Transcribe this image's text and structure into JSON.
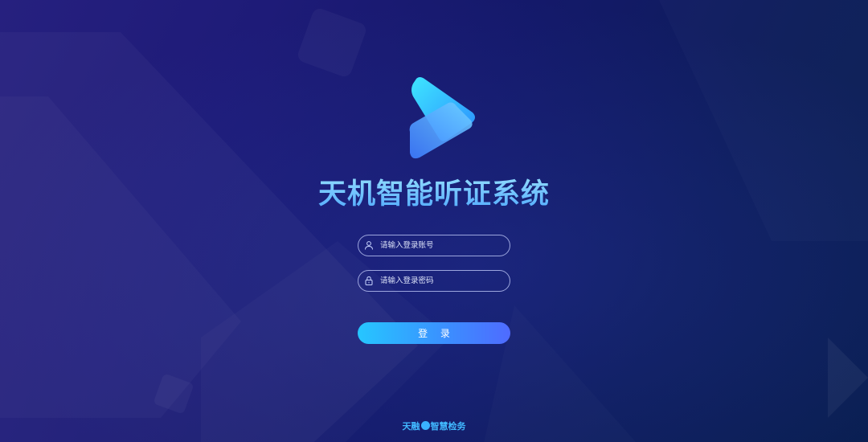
{
  "app": {
    "title": "天机智能听证系统"
  },
  "login_form": {
    "username": {
      "placeholder": "请输入登录账号",
      "value": "",
      "icon": "user-icon"
    },
    "password": {
      "placeholder": "请输入登录密码",
      "value": "",
      "icon": "lock-icon"
    },
    "submit_label": "登 录"
  },
  "footer": {
    "brand_prefix": "天融",
    "brand_suffix": "智慧检务",
    "logo_icon": "brand-mark-icon"
  },
  "colors": {
    "accent": "#3c8dff",
    "button_start": "#26c6ff",
    "button_end": "#4f6bff",
    "title": "#6fc2ff",
    "background": "#1a1b6e"
  }
}
